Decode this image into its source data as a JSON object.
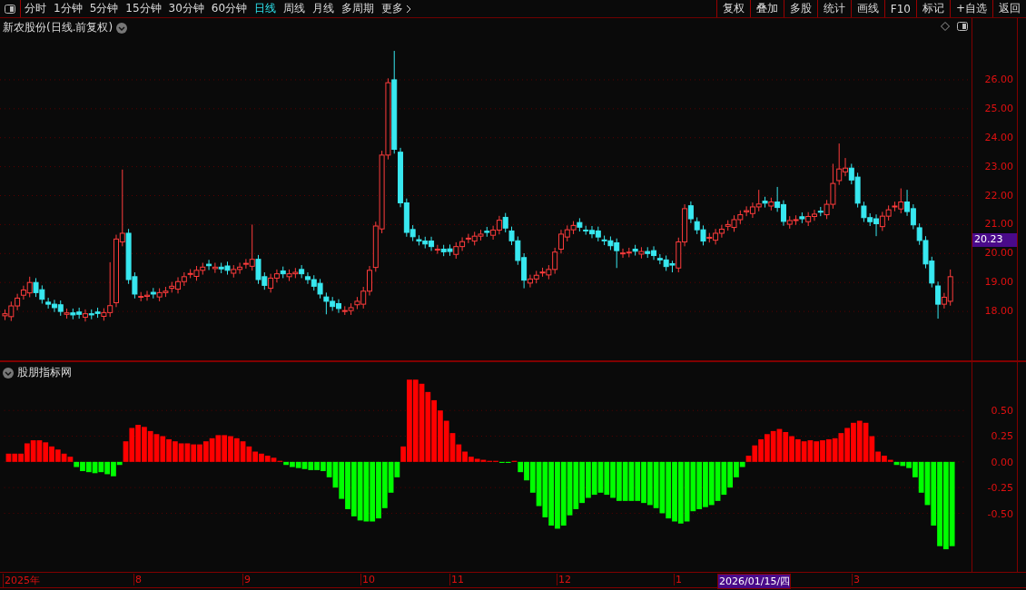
{
  "toolbar": {
    "periods": [
      {
        "label": "分时",
        "selected": false
      },
      {
        "label": "1分钟",
        "selected": false
      },
      {
        "label": "5分钟",
        "selected": false
      },
      {
        "label": "15分钟",
        "selected": false
      },
      {
        "label": "30分钟",
        "selected": false
      },
      {
        "label": "60分钟",
        "selected": false
      },
      {
        "label": "日线",
        "selected": true
      },
      {
        "label": "周线",
        "selected": false
      },
      {
        "label": "月线",
        "selected": false
      },
      {
        "label": "多周期",
        "selected": false
      }
    ],
    "more": "更多",
    "buttons": [
      "复权",
      "叠加",
      "多股",
      "统计",
      "画线",
      "F10",
      "标记",
      "+自选",
      "返回"
    ]
  },
  "price_panel": {
    "title": "新农股份(日线.前复权)",
    "current_price": "20.23",
    "chart_data": {
      "type": "candlestick",
      "ylim": [
        16.31,
        28.13
      ],
      "grid": true,
      "yticks": [
        {
          "value": 26,
          "label": "26.00"
        },
        {
          "value": 25,
          "label": "25.00"
        },
        {
          "value": 24,
          "label": "24.00"
        },
        {
          "value": 23,
          "label": "23.00"
        },
        {
          "value": 22,
          "label": "22.00"
        },
        {
          "value": 21,
          "label": "21.00"
        },
        {
          "value": 20,
          "label": "20.00"
        },
        {
          "value": 19,
          "label": "19.00"
        },
        {
          "value": 18,
          "label": "18.00"
        }
      ],
      "ohlc": [
        [
          17.85,
          18.07,
          17.7,
          17.92
        ],
        [
          17.82,
          18.34,
          17.67,
          18.19
        ],
        [
          18.19,
          18.61,
          18.04,
          18.46
        ],
        [
          18.56,
          18.89,
          18.41,
          18.74
        ],
        [
          18.64,
          19.2,
          18.49,
          19.0
        ],
        [
          19.0,
          19.15,
          18.5,
          18.65
        ],
        [
          18.75,
          18.9,
          18.27,
          18.42
        ],
        [
          18.32,
          18.47,
          18.1,
          18.25
        ],
        [
          18.25,
          18.4,
          17.98,
          18.13
        ],
        [
          18.23,
          18.38,
          17.85,
          18.0
        ],
        [
          17.9,
          18.1,
          17.75,
          17.95
        ],
        [
          17.95,
          18.1,
          17.73,
          17.88
        ],
        [
          17.98,
          18.13,
          17.75,
          17.9
        ],
        [
          17.8,
          18.07,
          17.65,
          17.92
        ],
        [
          17.92,
          18.07,
          17.73,
          17.88
        ],
        [
          17.98,
          18.13,
          17.78,
          17.93
        ],
        [
          17.83,
          18.11,
          17.68,
          17.96
        ],
        [
          17.96,
          19.7,
          17.81,
          18.2
        ],
        [
          18.3,
          20.65,
          18.15,
          20.5
        ],
        [
          20.4,
          22.9,
          20.25,
          20.7
        ],
        [
          20.7,
          20.85,
          18.95,
          19.1
        ],
        [
          19.2,
          19.35,
          18.45,
          18.6
        ],
        [
          18.5,
          18.67,
          18.35,
          18.52
        ],
        [
          18.52,
          18.71,
          18.37,
          18.56
        ],
        [
          18.66,
          18.81,
          18.45,
          18.6
        ],
        [
          18.5,
          18.8,
          18.35,
          18.65
        ],
        [
          18.65,
          18.85,
          18.5,
          18.7
        ],
        [
          18.8,
          19.02,
          18.65,
          18.87
        ],
        [
          18.77,
          19.18,
          18.62,
          19.03
        ],
        [
          19.03,
          19.35,
          18.88,
          19.2
        ],
        [
          19.3,
          19.46,
          19.15,
          19.31
        ],
        [
          19.21,
          19.57,
          19.06,
          19.42
        ],
        [
          19.42,
          19.68,
          19.27,
          19.53
        ],
        [
          19.63,
          19.78,
          19.43,
          19.58
        ],
        [
          19.48,
          19.68,
          19.33,
          19.53
        ],
        [
          19.53,
          19.68,
          19.32,
          19.47
        ],
        [
          19.57,
          19.72,
          19.27,
          19.42
        ],
        [
          19.32,
          19.6,
          19.17,
          19.45
        ],
        [
          19.45,
          19.68,
          19.3,
          19.53
        ],
        [
          19.63,
          19.81,
          19.48,
          19.66
        ],
        [
          19.56,
          21.0,
          19.41,
          19.8
        ],
        [
          19.8,
          19.95,
          18.95,
          19.1
        ],
        [
          19.2,
          19.35,
          18.75,
          18.9
        ],
        [
          18.8,
          19.3,
          18.65,
          19.15
        ],
        [
          19.15,
          19.45,
          19.0,
          19.3
        ],
        [
          19.4,
          19.55,
          19.15,
          19.3
        ],
        [
          19.2,
          19.45,
          19.05,
          19.3
        ],
        [
          19.3,
          19.5,
          19.15,
          19.35
        ],
        [
          19.45,
          19.6,
          19.15,
          19.3
        ],
        [
          19.2,
          19.35,
          18.95,
          19.1
        ],
        [
          19.1,
          19.25,
          18.72,
          18.87
        ],
        [
          18.97,
          19.12,
          18.45,
          18.6
        ],
        [
          18.5,
          18.65,
          17.9,
          18.35
        ],
        [
          18.35,
          18.5,
          18.02,
          18.17
        ],
        [
          18.27,
          18.42,
          17.95,
          18.1
        ],
        [
          18.0,
          18.18,
          17.88,
          18.03
        ],
        [
          18.03,
          18.28,
          17.88,
          18.13
        ],
        [
          18.23,
          18.5,
          18.08,
          18.35
        ],
        [
          18.25,
          18.85,
          18.1,
          18.7
        ],
        [
          18.7,
          19.57,
          18.55,
          19.42
        ],
        [
          19.52,
          21.1,
          19.37,
          20.95
        ],
        [
          20.85,
          23.55,
          20.7,
          23.4
        ],
        [
          23.4,
          26.05,
          23.25,
          25.9
        ],
        [
          26.0,
          27.0,
          23.45,
          23.6
        ],
        [
          23.5,
          23.65,
          21.6,
          21.75
        ],
        [
          21.75,
          21.9,
          20.58,
          20.73
        ],
        [
          20.83,
          20.98,
          20.43,
          20.58
        ],
        [
          20.48,
          20.63,
          20.28,
          20.43
        ],
        [
          20.43,
          20.58,
          20.18,
          20.33
        ],
        [
          20.43,
          20.58,
          20.09,
          20.24
        ],
        [
          20.14,
          20.3,
          19.99,
          20.15
        ],
        [
          20.15,
          20.3,
          19.91,
          20.06
        ],
        [
          20.16,
          20.31,
          19.92,
          20.07
        ],
        [
          19.97,
          20.39,
          19.82,
          20.24
        ],
        [
          20.24,
          20.56,
          20.09,
          20.41
        ],
        [
          20.51,
          20.68,
          20.36,
          20.53
        ],
        [
          20.43,
          20.75,
          20.28,
          20.6
        ],
        [
          20.6,
          20.82,
          20.45,
          20.67
        ],
        [
          20.77,
          20.92,
          20.58,
          20.73
        ],
        [
          20.63,
          20.96,
          20.48,
          20.81
        ],
        [
          20.81,
          21.3,
          20.66,
          21.15
        ],
        [
          21.25,
          21.4,
          20.73,
          20.88
        ],
        [
          20.78,
          20.93,
          20.29,
          20.44
        ],
        [
          20.44,
          20.59,
          19.61,
          19.76
        ],
        [
          19.86,
          20.01,
          18.8,
          19.08
        ],
        [
          18.98,
          19.27,
          18.83,
          19.12
        ],
        [
          19.12,
          19.4,
          18.97,
          19.25
        ],
        [
          19.35,
          19.51,
          19.2,
          19.36
        ],
        [
          19.26,
          19.6,
          19.11,
          19.45
        ],
        [
          19.45,
          20.2,
          19.3,
          20.05
        ],
        [
          20.15,
          20.82,
          20.0,
          20.67
        ],
        [
          20.57,
          20.97,
          20.42,
          20.82
        ],
        [
          20.82,
          21.12,
          20.67,
          20.97
        ],
        [
          21.07,
          21.22,
          20.76,
          20.91
        ],
        [
          20.81,
          20.96,
          20.65,
          20.8
        ],
        [
          20.8,
          20.95,
          20.53,
          20.68
        ],
        [
          20.78,
          20.93,
          20.42,
          20.57
        ],
        [
          20.47,
          20.62,
          20.29,
          20.44
        ],
        [
          20.44,
          20.59,
          20.12,
          20.27
        ],
        [
          20.37,
          20.52,
          19.5,
          20.1
        ],
        [
          20.0,
          20.17,
          19.85,
          20.02
        ],
        [
          20.02,
          20.2,
          19.87,
          20.05
        ],
        [
          20.15,
          20.3,
          19.93,
          20.08
        ],
        [
          19.98,
          20.22,
          19.83,
          20.07
        ],
        [
          20.07,
          20.22,
          19.85,
          20.0
        ],
        [
          20.1,
          20.25,
          19.78,
          19.93
        ],
        [
          19.83,
          19.98,
          19.63,
          19.78
        ],
        [
          19.78,
          19.93,
          19.4,
          19.55
        ],
        [
          19.65,
          19.75,
          19.35,
          19.6
        ],
        [
          19.5,
          20.55,
          19.35,
          20.4
        ],
        [
          20.4,
          21.7,
          20.25,
          21.55
        ],
        [
          21.65,
          21.8,
          21.05,
          21.2
        ],
        [
          21.1,
          21.25,
          20.67,
          20.82
        ],
        [
          20.82,
          20.97,
          20.28,
          20.43
        ],
        [
          20.53,
          20.71,
          20.38,
          20.56
        ],
        [
          20.46,
          20.85,
          20.31,
          20.7
        ],
        [
          20.7,
          20.99,
          20.55,
          20.84
        ],
        [
          20.94,
          21.15,
          20.79,
          21.0
        ],
        [
          20.9,
          21.32,
          20.75,
          21.17
        ],
        [
          21.17,
          21.49,
          21.02,
          21.34
        ],
        [
          21.44,
          21.63,
          21.29,
          21.48
        ],
        [
          21.38,
          21.76,
          21.23,
          21.61
        ],
        [
          21.61,
          22.2,
          21.46,
          21.71
        ],
        [
          21.81,
          21.96,
          21.59,
          21.74
        ],
        [
          21.64,
          21.93,
          21.49,
          21.78
        ],
        [
          21.78,
          22.3,
          21.44,
          21.59
        ],
        [
          21.69,
          21.84,
          20.96,
          21.11
        ],
        [
          21.01,
          21.29,
          20.86,
          21.14
        ],
        [
          21.14,
          21.32,
          20.99,
          21.17
        ],
        [
          21.27,
          21.42,
          21.05,
          21.2
        ],
        [
          21.1,
          21.43,
          20.95,
          21.28
        ],
        [
          21.28,
          21.51,
          21.13,
          21.36
        ],
        [
          21.46,
          21.61,
          21.29,
          21.44
        ],
        [
          21.34,
          21.85,
          21.19,
          21.7
        ],
        [
          21.7,
          23.1,
          21.55,
          22.42
        ],
        [
          22.52,
          23.8,
          22.37,
          22.92
        ],
        [
          22.82,
          23.3,
          22.67,
          22.95
        ],
        [
          22.95,
          23.1,
          22.39,
          22.54
        ],
        [
          22.64,
          22.79,
          21.59,
          21.74
        ],
        [
          21.64,
          21.79,
          21.09,
          21.24
        ],
        [
          21.24,
          21.39,
          20.95,
          21.1
        ],
        [
          21.2,
          21.35,
          20.6,
          21.03
        ],
        [
          20.93,
          21.44,
          20.78,
          21.29
        ],
        [
          21.29,
          21.66,
          21.14,
          21.51
        ],
        [
          21.61,
          21.79,
          21.46,
          21.64
        ],
        [
          21.54,
          22.25,
          21.39,
          21.78
        ],
        [
          21.78,
          22.2,
          21.3,
          21.45
        ],
        [
          21.55,
          21.7,
          20.84,
          20.99
        ],
        [
          20.89,
          21.04,
          20.3,
          20.45
        ],
        [
          20.45,
          20.6,
          19.49,
          19.64
        ],
        [
          19.74,
          19.89,
          18.83,
          18.98
        ],
        [
          18.88,
          19.03,
          17.75,
          18.25
        ],
        [
          18.25,
          18.64,
          18.1,
          18.49
        ],
        [
          18.35,
          19.45,
          18.2,
          19.2
        ]
      ]
    }
  },
  "indicator_panel": {
    "title": "股朋指标网",
    "chart_data": {
      "type": "bar",
      "ylim": [
        -1.07,
        0.97
      ],
      "yticks": [
        {
          "value": 0.5,
          "label": "0.50"
        },
        {
          "value": 0.25,
          "label": "0.25"
        },
        {
          "value": 0,
          "label": "0.00"
        },
        {
          "value": -0.25,
          "label": "-0.25"
        },
        {
          "value": -0.5,
          "label": "-0.50"
        }
      ],
      "grid": true,
      "series": [
        {
          "color": "#ff0000",
          "values": [
            0.08,
            0.08,
            0.08,
            0.18,
            0.21,
            0.21,
            0.19,
            0.15,
            0.12,
            0.08,
            0.05,
            null,
            null,
            null,
            null,
            null,
            null,
            null,
            null,
            0.2,
            0.33,
            0.36,
            0.34,
            0.3,
            0.27,
            0.25,
            0.22,
            0.2,
            0.18,
            0.18,
            0.17,
            0.17,
            0.2,
            0.23,
            0.26,
            0.26,
            0.25,
            0.23,
            0.2,
            0.15,
            0.1,
            0.08,
            0.06,
            0.04,
            0.01,
            null,
            null,
            null,
            null,
            null,
            null,
            null,
            null,
            null,
            null,
            null,
            null,
            null,
            null,
            null,
            null,
            null,
            null,
            null,
            0.15,
            0.8,
            0.8,
            0.76,
            0.68,
            0.6,
            0.5,
            0.4,
            0.28,
            0.17,
            0.1,
            0.05,
            0.03,
            0.02,
            0.01,
            0.01,
            null,
            null,
            0.01,
            null,
            null,
            null,
            null,
            null,
            null,
            null,
            null,
            null,
            null,
            null,
            null,
            null,
            null,
            null,
            null,
            null,
            null,
            null,
            null,
            null,
            null,
            null,
            null,
            null,
            null,
            null,
            null,
            null,
            null,
            null,
            null,
            null,
            null,
            null,
            null,
            null,
            0.06,
            0.16,
            0.22,
            0.27,
            0.3,
            0.32,
            0.29,
            0.25,
            0.22,
            0.2,
            0.21,
            0.2,
            0.21,
            0.22,
            0.23,
            0.28,
            0.33,
            0.38,
            0.4,
            0.38,
            0.25,
            0.1,
            0.06,
            0.02,
            null,
            null,
            null,
            null,
            null,
            null,
            null,
            null,
            null,
            null
          ]
        },
        {
          "color": "#00ff00",
          "values": [
            null,
            null,
            null,
            null,
            null,
            null,
            null,
            null,
            null,
            null,
            null,
            -0.05,
            -0.09,
            -0.1,
            -0.11,
            -0.1,
            -0.12,
            -0.14,
            -0.03,
            null,
            null,
            null,
            null,
            null,
            null,
            null,
            null,
            null,
            null,
            null,
            null,
            null,
            null,
            null,
            null,
            null,
            null,
            null,
            null,
            null,
            null,
            null,
            null,
            null,
            null,
            -0.03,
            -0.05,
            -0.06,
            -0.07,
            -0.08,
            -0.08,
            -0.09,
            -0.15,
            -0.25,
            -0.36,
            -0.46,
            -0.53,
            -0.57,
            -0.58,
            -0.58,
            -0.55,
            -0.45,
            -0.3,
            -0.15,
            null,
            null,
            null,
            null,
            null,
            null,
            null,
            null,
            null,
            null,
            null,
            null,
            null,
            null,
            null,
            null,
            -0.01,
            -0.01,
            null,
            -0.1,
            -0.18,
            -0.3,
            -0.43,
            -0.54,
            -0.62,
            -0.65,
            -0.62,
            -0.52,
            -0.46,
            -0.4,
            -0.35,
            -0.32,
            -0.3,
            -0.32,
            -0.35,
            -0.38,
            -0.38,
            -0.38,
            -0.38,
            -0.4,
            -0.42,
            -0.45,
            -0.5,
            -0.55,
            -0.58,
            -0.6,
            -0.58,
            -0.48,
            -0.46,
            -0.44,
            -0.42,
            -0.38,
            -0.32,
            -0.25,
            -0.15,
            -0.05,
            null,
            null,
            null,
            null,
            null,
            null,
            null,
            null,
            null,
            null,
            null,
            null,
            null,
            null,
            null,
            null,
            null,
            null,
            null,
            null,
            null,
            null,
            null,
            null,
            -0.03,
            -0.04,
            -0.06,
            -0.15,
            -0.3,
            -0.42,
            -0.62,
            -0.82,
            -0.85,
            -0.82
          ]
        }
      ]
    }
  },
  "x_axis": [
    {
      "label": "2025年",
      "kind": "month"
    },
    {
      "label": "8",
      "kind": "month"
    },
    {
      "label": "9",
      "kind": "month"
    },
    {
      "label": "10",
      "kind": "month"
    },
    {
      "label": "11",
      "kind": "month"
    },
    {
      "label": "12",
      "kind": "month"
    },
    {
      "label": "1",
      "kind": "month"
    },
    {
      "label": "2026/01/15/四",
      "kind": "cursor"
    },
    {
      "label": "3",
      "kind": "month"
    }
  ]
}
